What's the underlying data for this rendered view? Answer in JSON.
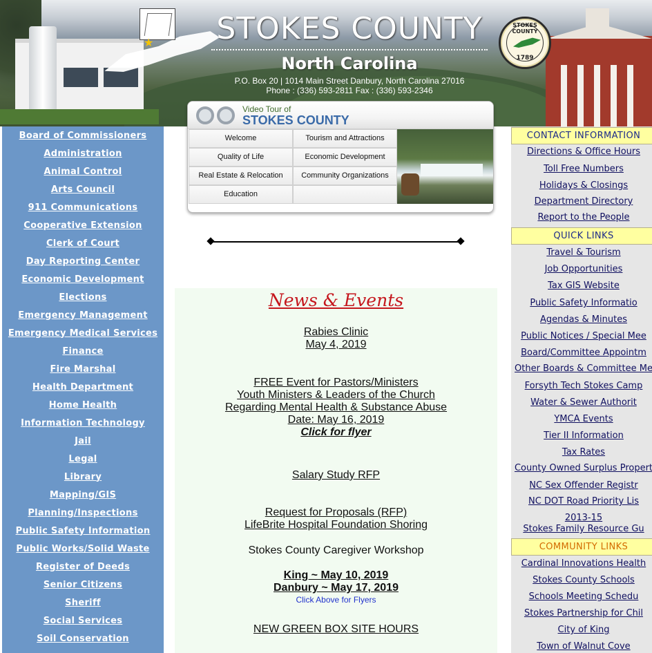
{
  "header": {
    "title": "STOKES COUNTY",
    "subtitle": "North Carolina",
    "address_line1": "P.O. Box 20  | 1014 Main Street Danbury, North Carolina 27016",
    "address_line2": "Phone : (336) 593-2811  Fax : (336) 593-2346",
    "seal_top": "STOKES COUNTY",
    "seal_year": "1789"
  },
  "video_tour": {
    "label_top": "Video Tour of",
    "label_main": "STOKES COUNTY",
    "items": [
      "Welcome",
      "Tourism and Attractions",
      "Quality of Life",
      "Economic Development",
      "Real Estate & Relocation",
      "Community Organizations",
      "Education",
      ""
    ]
  },
  "left_nav": [
    "Board of Commissioners",
    "Administration",
    "Animal Control",
    "Arts Council",
    "911 Communications",
    "Cooperative Extension",
    "Clerk of Court",
    "Day Reporting Center",
    "Economic Development",
    "Elections",
    "Emergency Management",
    "Emergency Medical Services",
    "Finance",
    "Fire Marshal",
    "Health Department",
    "Home Health",
    "Information Technology",
    "Jail",
    "Legal",
    "Library",
    "Mapping/GIS",
    "Planning/Inspections",
    "Public Safety Information",
    "Public Works/Solid Waste",
    "Register of Deeds",
    "Senior Citizens",
    "Sheriff",
    "Social Services",
    "Soil Conservation"
  ],
  "news": {
    "title": "News & Events",
    "rabies_1": "Rabies Clinic",
    "rabies_2": "May 4, 2019",
    "pastors_1": "FREE Event for Pastors/Ministers",
    "pastors_2": "Youth Ministers & Leaders of the Church",
    "pastors_3": "Regarding Mental Health & Substance Abuse",
    "pastors_4": "Date: May 16, 2019",
    "pastors_5": "Click for flyer",
    "salary": "Salary Study RFP",
    "rfp_1": "Request for Proposals (RFP)",
    "rfp_2": "LifeBrite Hospital Foundation Shoring",
    "caregiver": "Stokes County Caregiver Workshop",
    "king": "King ~ May 10, 2019",
    "danbury": "Danbury ~ May 17, 2019",
    "click_above": "Click Above for Flyers",
    "greenbox": "NEW GREEN BOX SITE HOURS"
  },
  "right": {
    "contact_header": "CONTACT INFORMATION",
    "contact_links": [
      "Directions & Office Hours",
      "Toll Free Numbers",
      "Holidays & Closings",
      "Department Directory",
      "Report to the People"
    ],
    "quick_header": "QUICK LINKS",
    "quick_links": [
      "Travel & Tourism",
      "Job Opportunities",
      "Tax GIS Website",
      "Public Safety Informatio",
      "Agendas & Minutes",
      "Public Notices / Special Mee",
      "Board/Committee Appointm",
      "Other Boards & Committee Me",
      "Forsyth Tech Stokes Camp",
      "Water & Sewer Authorit",
      "YMCA Events",
      "Tier II Information",
      "Tax Rates",
      "County Owned Surplus Propert",
      "NC Sex Offender Registr",
      "NC DOT Road Priority Lis",
      "2013-15",
      "Stokes Family Resource Gu"
    ],
    "community_header": "COMMUNITY LINKS",
    "community_links": [
      "Cardinal Innovations Health",
      "Stokes County Schools",
      "Schools Meeting Schedu",
      "Stokes Partnership for Chil",
      "City of King",
      "Town of Walnut Cove"
    ]
  },
  "colors": {
    "left_nav_bg": "#6c97c8",
    "news_title": "#c5161d",
    "right_header_bg": "#ffffa0",
    "community_header_text": "#d36a00"
  }
}
